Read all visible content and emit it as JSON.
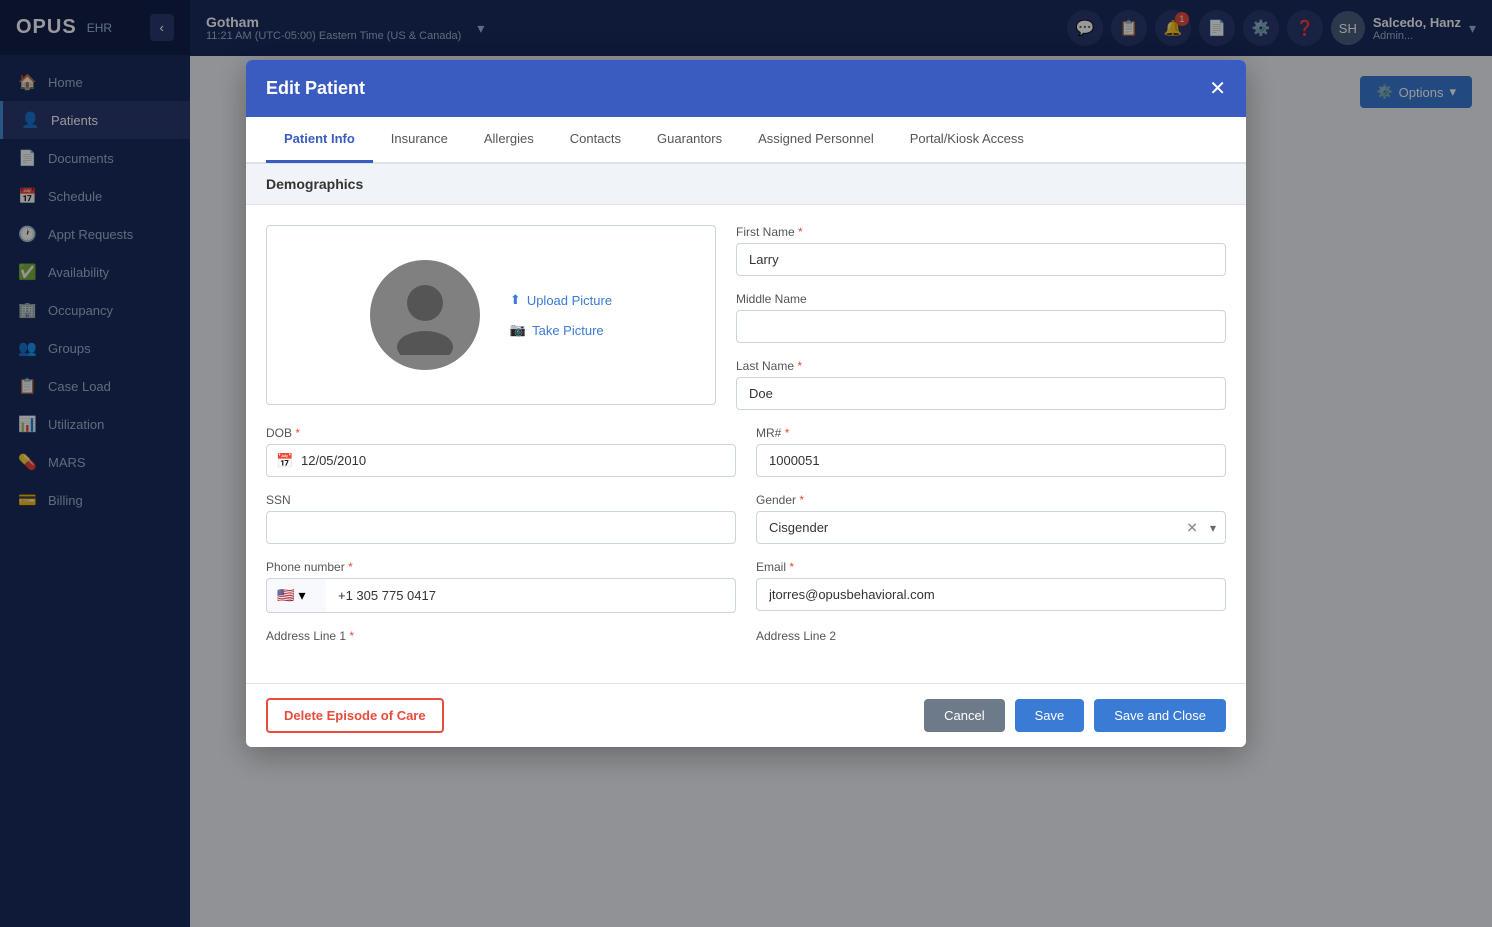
{
  "app": {
    "name": "OPUS",
    "sub": "EHR"
  },
  "topbar": {
    "location_name": "Gotham",
    "location_time": "11:21 AM (UTC-05:00) Eastern Time (US & Canada)",
    "notification_count": "1",
    "user_name": "Salcedo, Hanz",
    "user_role": "Admin..."
  },
  "sidebar": {
    "items": [
      {
        "label": "Home",
        "icon": "🏠"
      },
      {
        "label": "Patients",
        "icon": "👤"
      },
      {
        "label": "Documents",
        "icon": "📄"
      },
      {
        "label": "Schedule",
        "icon": "📅"
      },
      {
        "label": "Appt Requests",
        "icon": "🕐"
      },
      {
        "label": "Availability",
        "icon": "✅"
      },
      {
        "label": "Occupancy",
        "icon": "🏢"
      },
      {
        "label": "Groups",
        "icon": "👥"
      },
      {
        "label": "Case Load",
        "icon": "📋"
      },
      {
        "label": "Utilization",
        "icon": "📊"
      },
      {
        "label": "MARS",
        "icon": "💊"
      },
      {
        "label": "Billing",
        "icon": "💳"
      }
    ],
    "active_item": "Patients"
  },
  "modal": {
    "title": "Edit Patient",
    "tabs": [
      {
        "label": "Patient Info",
        "active": true
      },
      {
        "label": "Insurance"
      },
      {
        "label": "Allergies"
      },
      {
        "label": "Contacts"
      },
      {
        "label": "Guarantors"
      },
      {
        "label": "Assigned Personnel"
      },
      {
        "label": "Portal/Kiosk Access"
      }
    ],
    "section": "Demographics",
    "form": {
      "first_name_label": "First Name",
      "first_name_value": "Larry",
      "middle_name_label": "Middle Name",
      "middle_name_value": "",
      "last_name_label": "Last Name",
      "last_name_value": "Doe",
      "dob_label": "DOB",
      "dob_value": "12/05/2010",
      "mr_label": "MR#",
      "mr_value": "1000051",
      "ssn_label": "SSN",
      "ssn_value": "",
      "gender_label": "Gender",
      "gender_value": "Cisgender",
      "phone_label": "Phone number",
      "phone_flag": "🇺🇸",
      "phone_value": "+1 305 775 0417",
      "email_label": "Email",
      "email_value": "jtorres@opusbehavioral.com",
      "address1_label": "Address Line 1",
      "address2_label": "Address Line 2",
      "upload_picture": "Upload Picture",
      "take_picture": "Take Picture"
    },
    "footer": {
      "delete_btn": "Delete Episode of Care",
      "cancel_btn": "Cancel",
      "save_btn": "Save",
      "save_close_btn": "Save and Close"
    }
  },
  "page": {
    "options_btn": "Options"
  }
}
